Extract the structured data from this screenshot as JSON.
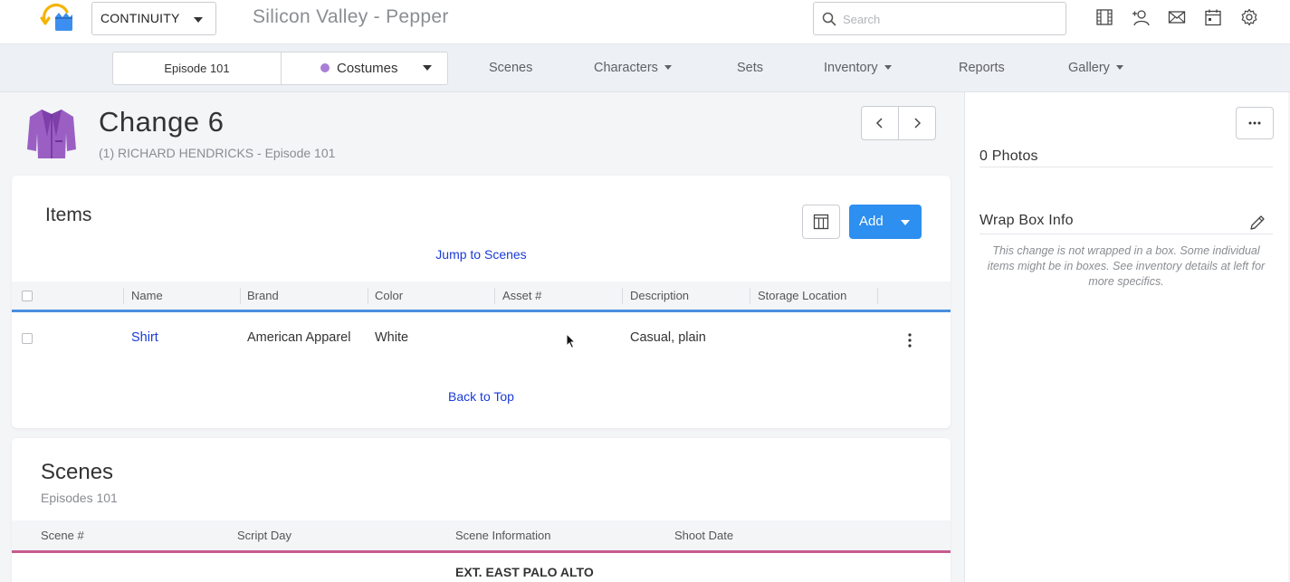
{
  "app": {
    "module_select": "CONTINUITY",
    "project_title": "Silicon Valley - Pepper"
  },
  "search": {
    "placeholder": "Search",
    "value": ""
  },
  "top_icons": [
    "film-icon",
    "add-user-icon",
    "mail-icon",
    "calendar-icon",
    "gear-icon"
  ],
  "nav": {
    "episode": "Episode 101",
    "department": "Costumes",
    "department_color": "#a97fd6",
    "items": [
      {
        "label": "Scenes",
        "dropdown": false
      },
      {
        "label": "Characters",
        "dropdown": true
      },
      {
        "label": "Sets",
        "dropdown": false
      },
      {
        "label": "Inventory",
        "dropdown": true
      },
      {
        "label": "Reports",
        "dropdown": false
      },
      {
        "label": "Gallery",
        "dropdown": true
      }
    ]
  },
  "header": {
    "title": "Change 6",
    "subtitle": "(1) RICHARD HENDRICKS - Episode 101"
  },
  "items_card": {
    "title": "Items",
    "jump_link": "Jump to Scenes",
    "add_label": "Add",
    "add_color": "#2d8ff0",
    "columns": [
      "Name",
      "Brand",
      "Color",
      "Asset #",
      "Description",
      "Storage Location"
    ],
    "rows": [
      {
        "name": "Shirt",
        "brand": "American Apparel",
        "color": "White",
        "asset": "",
        "description": "Casual, plain",
        "storage": ""
      }
    ],
    "back_to_top": "Back to Top"
  },
  "scenes_card": {
    "title": "Scenes",
    "subtitle": "Episodes 101",
    "columns": [
      "Scene #",
      "Script Day",
      "Scene Information",
      "Shoot Date"
    ],
    "first_row_info": "EXT. EAST PALO ALTO"
  },
  "right_panel": {
    "photos_label": "0 Photos",
    "wrap_label": "Wrap Box Info",
    "wrap_note": "This change is not wrapped in a box. Some individual items might be in boxes. See inventory details at left for more specifics."
  }
}
